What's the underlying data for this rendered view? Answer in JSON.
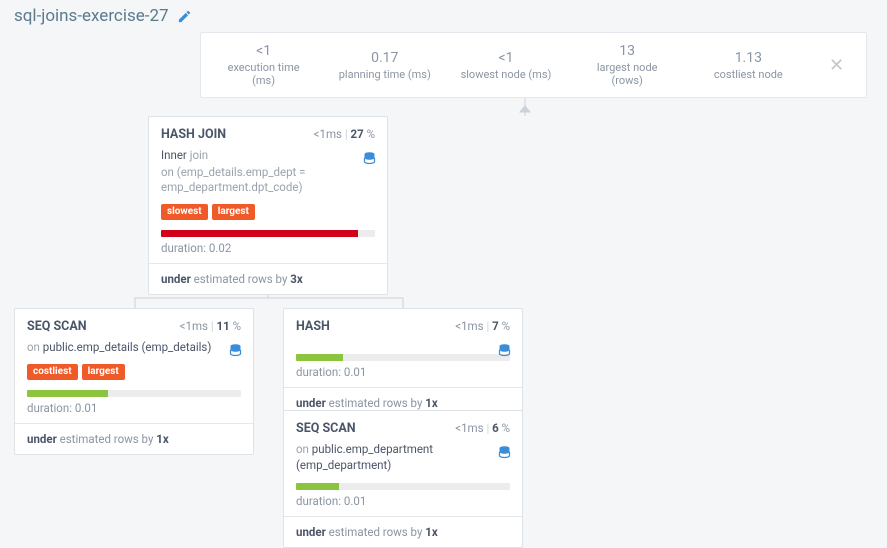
{
  "title": "sql-joins-exercise-27",
  "stats": {
    "execution_time": {
      "value": "<1",
      "label": "execution time (ms)"
    },
    "planning_time": {
      "value": "0.17",
      "label": "planning time (ms)"
    },
    "slowest_node": {
      "value": "<1",
      "label": "slowest node (ms)"
    },
    "largest_node": {
      "value": "13",
      "label": "largest node (rows)"
    },
    "costliest_node": {
      "value": "1.13",
      "label": "costliest node"
    }
  },
  "nodes": {
    "hashjoin": {
      "title": "HASH JOIN",
      "time": "<1ms",
      "pct": "27",
      "sub_prefix": "Inner ",
      "sub_rest": "join",
      "cond": "on (emp_details.emp_dept = emp_department.dpt_code)",
      "tags": [
        "slowest",
        "largest"
      ],
      "bar_width": "92%",
      "bar_color": "bar-red",
      "duration": "duration: 0.02",
      "est_prefix": "under",
      "est_mid": " estimated rows by ",
      "est_factor": "3x"
    },
    "seqscan1": {
      "title": "SEQ SCAN",
      "time": "<1ms",
      "pct": "11",
      "sub_prefix": "on ",
      "sub_rest": "public.emp_details (emp_details)",
      "tags": [
        "costliest",
        "largest"
      ],
      "bar_width": "38%",
      "bar_color": "bar-green",
      "duration": "duration: 0.01",
      "est_prefix": "under",
      "est_mid": " estimated rows by ",
      "est_factor": "1x"
    },
    "hash": {
      "title": "HASH",
      "time": "<1ms",
      "pct": "7",
      "bar_width": "22%",
      "bar_color": "bar-green",
      "duration": "duration: 0.01",
      "est_prefix": "under",
      "est_mid": " estimated rows by ",
      "est_factor": "1x"
    },
    "seqscan2": {
      "title": "SEQ SCAN",
      "time": "<1ms",
      "pct": "6",
      "sub_prefix": "on ",
      "sub_rest": "public.emp_department (emp_department)",
      "bar_width": "20%",
      "bar_color": "bar-green",
      "duration": "duration: 0.01",
      "est_prefix": "under",
      "est_mid": " estimated rows by ",
      "est_factor": "1x"
    }
  }
}
